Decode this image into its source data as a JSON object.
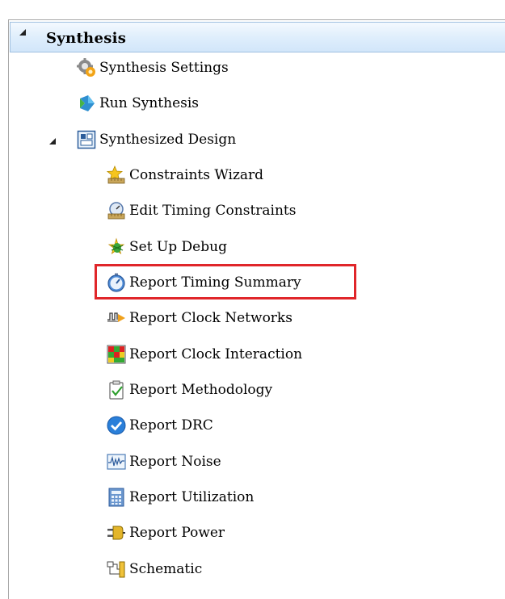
{
  "tree": {
    "root": {
      "label": "Synthesis"
    },
    "items": [
      {
        "label": "Synthesis Settings",
        "icon": "gear-icon"
      },
      {
        "label": "Run Synthesis",
        "icon": "run-icon"
      },
      {
        "label": "Synthesized Design",
        "icon": "design-icon"
      },
      {
        "label": "Constraints Wizard",
        "icon": "wizard-icon"
      },
      {
        "label": "Edit Timing Constraints",
        "icon": "timing-constraints-icon"
      },
      {
        "label": "Set Up Debug",
        "icon": "debug-icon"
      },
      {
        "label": "Report Timing Summary",
        "icon": "stopwatch-icon"
      },
      {
        "label": "Report Clock Networks",
        "icon": "clock-network-icon"
      },
      {
        "label": "Report Clock Interaction",
        "icon": "clock-interaction-icon"
      },
      {
        "label": "Report Methodology",
        "icon": "methodology-icon"
      },
      {
        "label": "Report DRC",
        "icon": "drc-check-icon"
      },
      {
        "label": "Report Noise",
        "icon": "noise-icon"
      },
      {
        "label": "Report Utilization",
        "icon": "utilization-icon"
      },
      {
        "label": "Report Power",
        "icon": "power-icon"
      },
      {
        "label": "Schematic",
        "icon": "schematic-icon"
      }
    ]
  },
  "colors": {
    "highlight": "#e0262a",
    "header_bg": "#dfeefc"
  }
}
